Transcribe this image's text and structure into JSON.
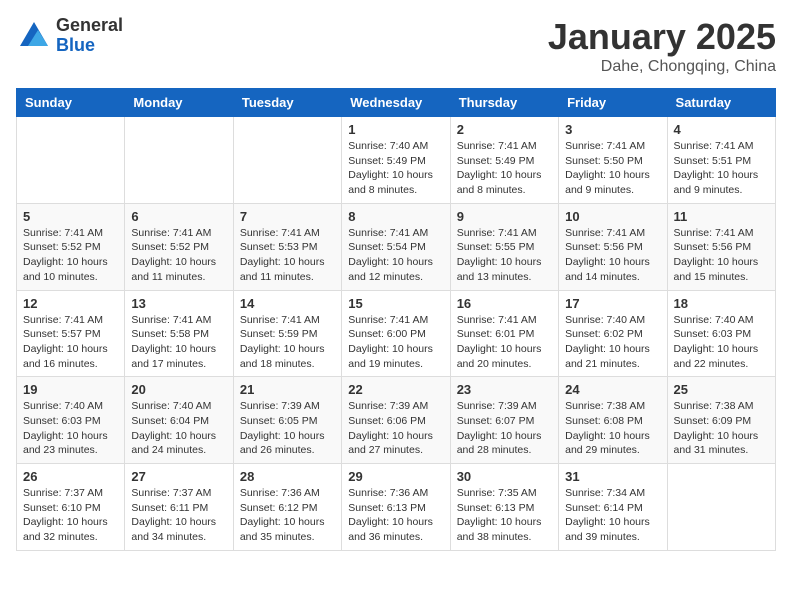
{
  "header": {
    "logo_general": "General",
    "logo_blue": "Blue",
    "month_title": "January 2025",
    "location": "Dahe, Chongqing, China"
  },
  "weekdays": [
    "Sunday",
    "Monday",
    "Tuesday",
    "Wednesday",
    "Thursday",
    "Friday",
    "Saturday"
  ],
  "weeks": [
    [
      {
        "day": "",
        "info": ""
      },
      {
        "day": "",
        "info": ""
      },
      {
        "day": "",
        "info": ""
      },
      {
        "day": "1",
        "info": "Sunrise: 7:40 AM\nSunset: 5:49 PM\nDaylight: 10 hours and 8 minutes."
      },
      {
        "day": "2",
        "info": "Sunrise: 7:41 AM\nSunset: 5:49 PM\nDaylight: 10 hours and 8 minutes."
      },
      {
        "day": "3",
        "info": "Sunrise: 7:41 AM\nSunset: 5:50 PM\nDaylight: 10 hours and 9 minutes."
      },
      {
        "day": "4",
        "info": "Sunrise: 7:41 AM\nSunset: 5:51 PM\nDaylight: 10 hours and 9 minutes."
      }
    ],
    [
      {
        "day": "5",
        "info": "Sunrise: 7:41 AM\nSunset: 5:52 PM\nDaylight: 10 hours and 10 minutes."
      },
      {
        "day": "6",
        "info": "Sunrise: 7:41 AM\nSunset: 5:52 PM\nDaylight: 10 hours and 11 minutes."
      },
      {
        "day": "7",
        "info": "Sunrise: 7:41 AM\nSunset: 5:53 PM\nDaylight: 10 hours and 11 minutes."
      },
      {
        "day": "8",
        "info": "Sunrise: 7:41 AM\nSunset: 5:54 PM\nDaylight: 10 hours and 12 minutes."
      },
      {
        "day": "9",
        "info": "Sunrise: 7:41 AM\nSunset: 5:55 PM\nDaylight: 10 hours and 13 minutes."
      },
      {
        "day": "10",
        "info": "Sunrise: 7:41 AM\nSunset: 5:56 PM\nDaylight: 10 hours and 14 minutes."
      },
      {
        "day": "11",
        "info": "Sunrise: 7:41 AM\nSunset: 5:56 PM\nDaylight: 10 hours and 15 minutes."
      }
    ],
    [
      {
        "day": "12",
        "info": "Sunrise: 7:41 AM\nSunset: 5:57 PM\nDaylight: 10 hours and 16 minutes."
      },
      {
        "day": "13",
        "info": "Sunrise: 7:41 AM\nSunset: 5:58 PM\nDaylight: 10 hours and 17 minutes."
      },
      {
        "day": "14",
        "info": "Sunrise: 7:41 AM\nSunset: 5:59 PM\nDaylight: 10 hours and 18 minutes."
      },
      {
        "day": "15",
        "info": "Sunrise: 7:41 AM\nSunset: 6:00 PM\nDaylight: 10 hours and 19 minutes."
      },
      {
        "day": "16",
        "info": "Sunrise: 7:41 AM\nSunset: 6:01 PM\nDaylight: 10 hours and 20 minutes."
      },
      {
        "day": "17",
        "info": "Sunrise: 7:40 AM\nSunset: 6:02 PM\nDaylight: 10 hours and 21 minutes."
      },
      {
        "day": "18",
        "info": "Sunrise: 7:40 AM\nSunset: 6:03 PM\nDaylight: 10 hours and 22 minutes."
      }
    ],
    [
      {
        "day": "19",
        "info": "Sunrise: 7:40 AM\nSunset: 6:03 PM\nDaylight: 10 hours and 23 minutes."
      },
      {
        "day": "20",
        "info": "Sunrise: 7:40 AM\nSunset: 6:04 PM\nDaylight: 10 hours and 24 minutes."
      },
      {
        "day": "21",
        "info": "Sunrise: 7:39 AM\nSunset: 6:05 PM\nDaylight: 10 hours and 26 minutes."
      },
      {
        "day": "22",
        "info": "Sunrise: 7:39 AM\nSunset: 6:06 PM\nDaylight: 10 hours and 27 minutes."
      },
      {
        "day": "23",
        "info": "Sunrise: 7:39 AM\nSunset: 6:07 PM\nDaylight: 10 hours and 28 minutes."
      },
      {
        "day": "24",
        "info": "Sunrise: 7:38 AM\nSunset: 6:08 PM\nDaylight: 10 hours and 29 minutes."
      },
      {
        "day": "25",
        "info": "Sunrise: 7:38 AM\nSunset: 6:09 PM\nDaylight: 10 hours and 31 minutes."
      }
    ],
    [
      {
        "day": "26",
        "info": "Sunrise: 7:37 AM\nSunset: 6:10 PM\nDaylight: 10 hours and 32 minutes."
      },
      {
        "day": "27",
        "info": "Sunrise: 7:37 AM\nSunset: 6:11 PM\nDaylight: 10 hours and 34 minutes."
      },
      {
        "day": "28",
        "info": "Sunrise: 7:36 AM\nSunset: 6:12 PM\nDaylight: 10 hours and 35 minutes."
      },
      {
        "day": "29",
        "info": "Sunrise: 7:36 AM\nSunset: 6:13 PM\nDaylight: 10 hours and 36 minutes."
      },
      {
        "day": "30",
        "info": "Sunrise: 7:35 AM\nSunset: 6:13 PM\nDaylight: 10 hours and 38 minutes."
      },
      {
        "day": "31",
        "info": "Sunrise: 7:34 AM\nSunset: 6:14 PM\nDaylight: 10 hours and 39 minutes."
      },
      {
        "day": "",
        "info": ""
      }
    ]
  ]
}
